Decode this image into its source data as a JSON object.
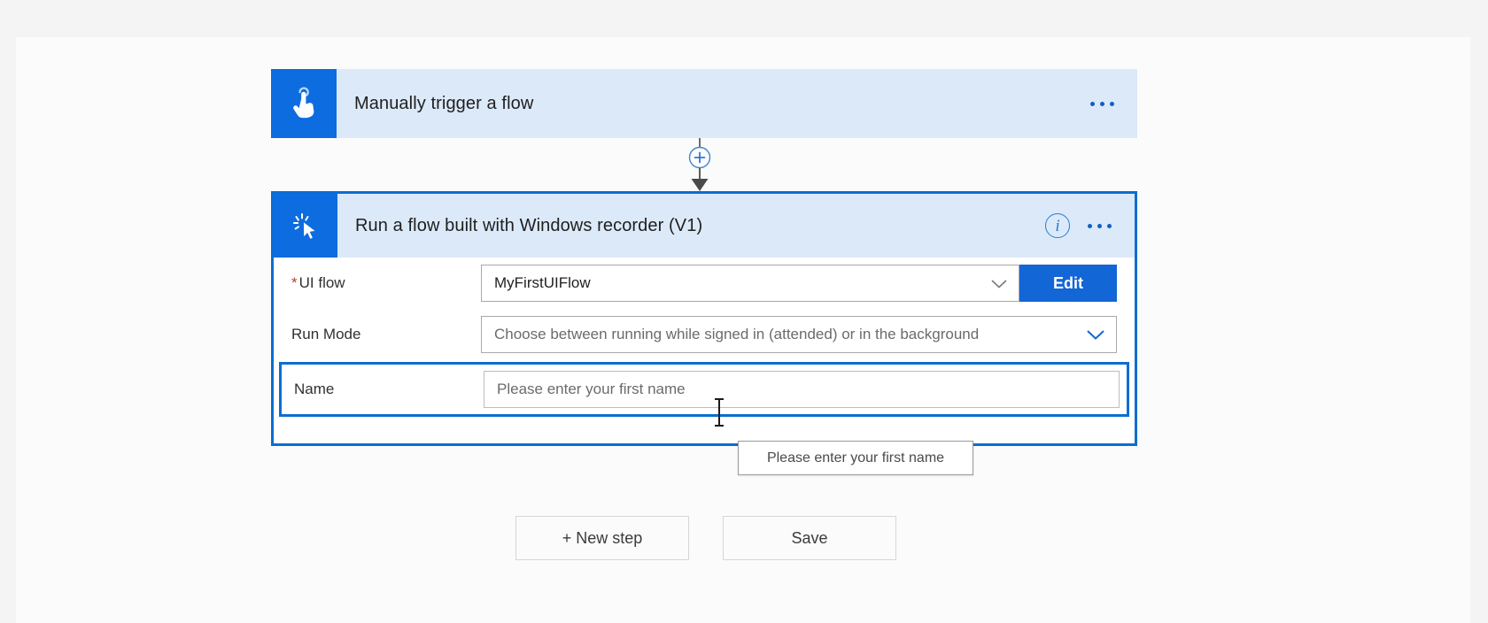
{
  "flow": {
    "trigger": {
      "title": "Manually trigger a flow",
      "icon": "touch-hand-icon",
      "menu_icon": "ellipsis-icon",
      "header_bg": "#dce9f9",
      "icon_bg": "#0d6ce0"
    },
    "connector": {
      "icon": "add-step-plus-icon",
      "accent": "#2a7bd1"
    },
    "action": {
      "title": "Run a flow built with Windows recorder (V1)",
      "icon": "cursor-click-icon",
      "info_icon": "info-icon",
      "info_glyph": "i",
      "menu_icon": "ellipsis-icon",
      "selected_border": "#0a6ed1",
      "fields": [
        {
          "label": "UI flow",
          "required": true,
          "required_marker": "*",
          "value": "MyFirstUIFlow",
          "is_placeholder": false,
          "chevron_icon": "chevron-down-icon",
          "chevron_color": "#7a7a7a",
          "button": {
            "label": "Edit",
            "bg": "#1266d6",
            "fg": "#ffffff"
          }
        },
        {
          "label": "Run Mode",
          "required": false,
          "value": "Choose between running while signed in (attended) or in the background",
          "is_placeholder": true,
          "chevron_icon": "chevron-down-icon",
          "chevron_color": "#1266d6"
        },
        {
          "label": "Name",
          "required": false,
          "value": "Please enter your first name",
          "is_placeholder": true,
          "focused": true
        }
      ]
    }
  },
  "tooltip": {
    "text": "Please enter your first name"
  },
  "footer": {
    "new_step_label": "+ New step",
    "save_label": "Save"
  }
}
